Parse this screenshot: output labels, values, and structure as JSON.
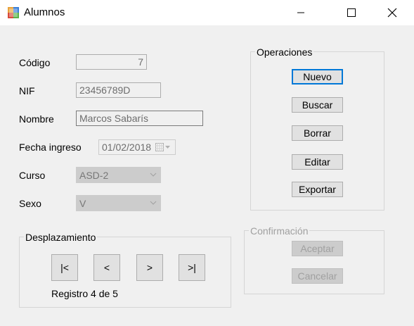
{
  "window": {
    "title": "Alumnos"
  },
  "form": {
    "codigo": {
      "label": "Código",
      "value": "7"
    },
    "nif": {
      "label": "NIF",
      "value": "23456789D"
    },
    "nombre": {
      "label": "Nombre",
      "value": "Marcos Sabarís"
    },
    "fecha": {
      "label": "Fecha ingreso",
      "value": "01/02/2018"
    },
    "curso": {
      "label": "Curso",
      "value": "ASD-2"
    },
    "sexo": {
      "label": "Sexo",
      "value": "V"
    }
  },
  "operaciones": {
    "title": "Operaciones",
    "nuevo": "Nuevo",
    "buscar": "Buscar",
    "borrar": "Borrar",
    "editar": "Editar",
    "exportar": "Exportar"
  },
  "confirmacion": {
    "title": "Confirmación",
    "aceptar": "Aceptar",
    "cancelar": "Cancelar"
  },
  "desplazamiento": {
    "title": "Desplazamiento",
    "first": "|<",
    "prev": "<",
    "next": ">",
    "last": ">|",
    "registro": "Registro 4 de 5"
  }
}
